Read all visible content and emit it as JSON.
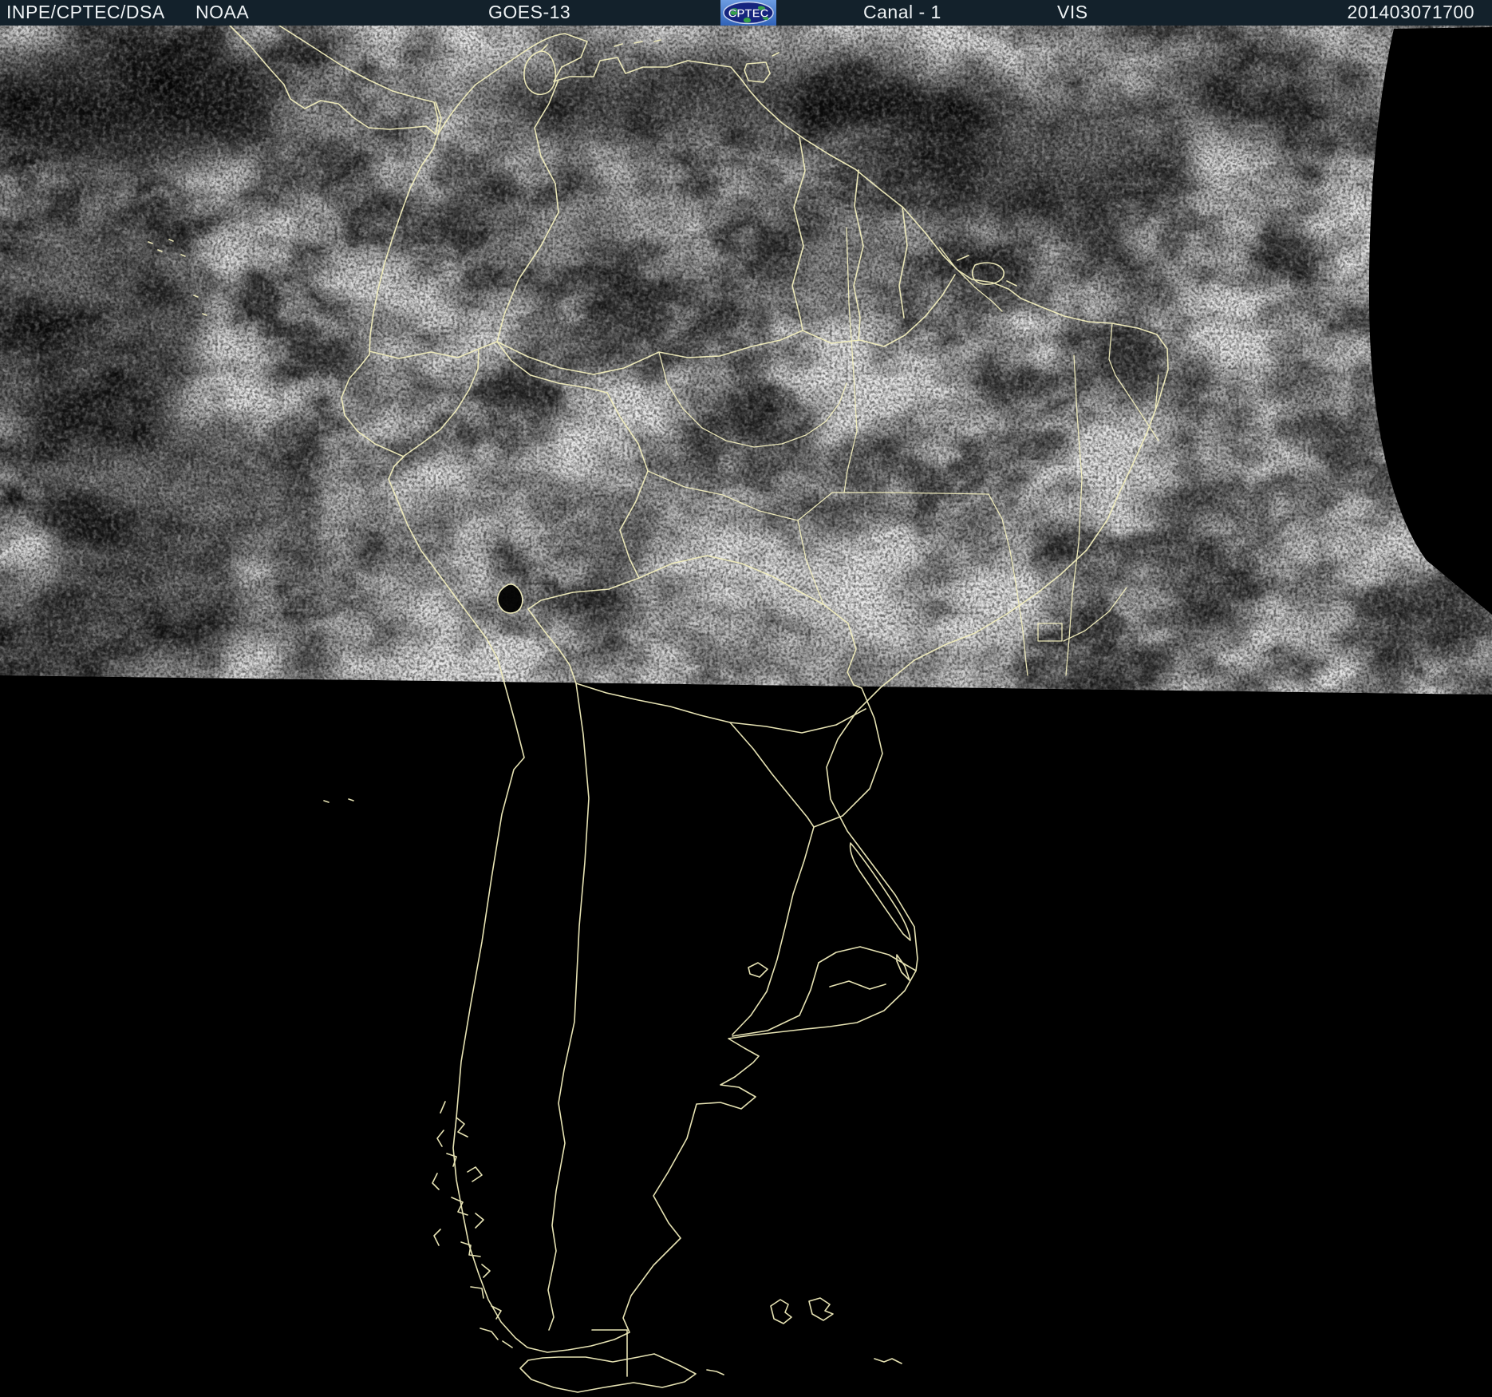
{
  "header": {
    "agency": "INPE/CPTEC/DSA",
    "noaa": "NOAA",
    "satellite": "GOES-13",
    "logo_text": "CPTEC",
    "channel": "Canal - 1",
    "band": "VIS",
    "timestamp": "201403071700"
  },
  "colors": {
    "header_bg": "#13212b",
    "header_text": "#eef2f4",
    "map_border_line": "#f3efbd",
    "night_region": "#000000",
    "daylight_base_gray": "#454545",
    "logo_box_blue": "#4f7fd0",
    "logo_ellipse_blue": "#16247e",
    "logo_land_green": "#37a14b"
  },
  "map": {
    "region": "South America",
    "image_kind": "visible-channel satellite image with political borders overlay"
  }
}
